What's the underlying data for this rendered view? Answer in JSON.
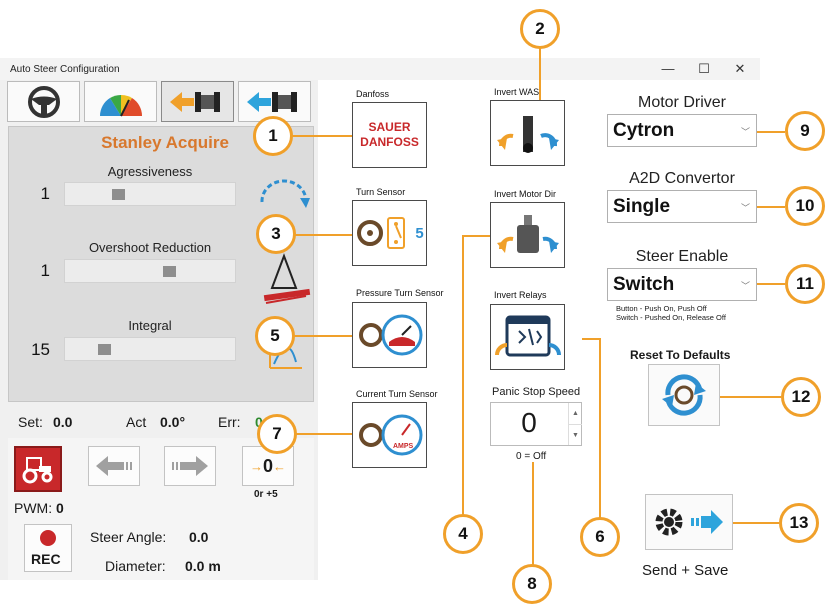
{
  "window": {
    "title": "Auto Steer Configuration",
    "minimize": "—",
    "maximize": "☐",
    "close": "✕"
  },
  "tabs": [
    {
      "name": "steering-wheel",
      "selected": false
    },
    {
      "name": "gauge",
      "selected": false
    },
    {
      "name": "tractor-front",
      "selected": true
    },
    {
      "name": "tractor-back",
      "selected": false
    }
  ],
  "mode": {
    "title": "Stanley Acquire"
  },
  "sliders": [
    {
      "label": "Agressiveness",
      "value": "1",
      "level": 0.3
    },
    {
      "label": "Overshoot Reduction",
      "value": "1",
      "level": 0.58
    },
    {
      "label": "Integral",
      "value": "15",
      "level": 0.2
    }
  ],
  "status": {
    "set_label": "Set:",
    "set_value": "0.0",
    "act_label": "Act",
    "act_value": "0.0°",
    "err_label": "Err:",
    "err_value": "0"
  },
  "controls": {
    "pwm_label": "PWM:",
    "pwm_value": "0",
    "center_value": "0",
    "center_note": "0r +5",
    "rec_label": "REC",
    "steer_angle_label": "Steer Angle:",
    "steer_angle_value": "0.0",
    "diameter_label": "Diameter:",
    "diameter_value": "0.0 m"
  },
  "middle": {
    "danfoss_label": "Danfoss",
    "danfoss_logo_top": "SAUER",
    "danfoss_logo_bottom": "DANFOSS",
    "turn_sensor_label": "Turn Sensor",
    "turn_sensor_value": "5",
    "pressure_label": "Pressure Turn Sensor",
    "current_label": "Current Turn Sensor",
    "amps_text": "AMPS",
    "invert_was_label": "Invert WAS",
    "invert_motor_label": "Invert Motor Dir",
    "invert_relays_label": "Invert Relays",
    "panic_label": "Panic Stop Speed",
    "panic_value": "0",
    "panic_note": "0 = Off"
  },
  "right": {
    "motor_driver_label": "Motor Driver",
    "motor_driver_value": "Cytron",
    "a2d_label": "A2D Convertor",
    "a2d_value": "Single",
    "steer_enable_label": "Steer Enable",
    "steer_enable_value": "Switch",
    "steer_note_1": "Button - Push On, Push Off",
    "steer_note_2": "Switch - Pushed On, Release Off",
    "reset_label": "Reset To Defaults",
    "send_save_label": "Send +  Save"
  },
  "callouts": [
    "1",
    "2",
    "3",
    "4",
    "5",
    "6",
    "7",
    "8",
    "9",
    "10",
    "11",
    "12",
    "13"
  ],
  "colors": {
    "accent_orange": "#f0a02a",
    "mode_title": "#d8782d",
    "blue": "#2e8fd0",
    "red": "#c8282a"
  }
}
